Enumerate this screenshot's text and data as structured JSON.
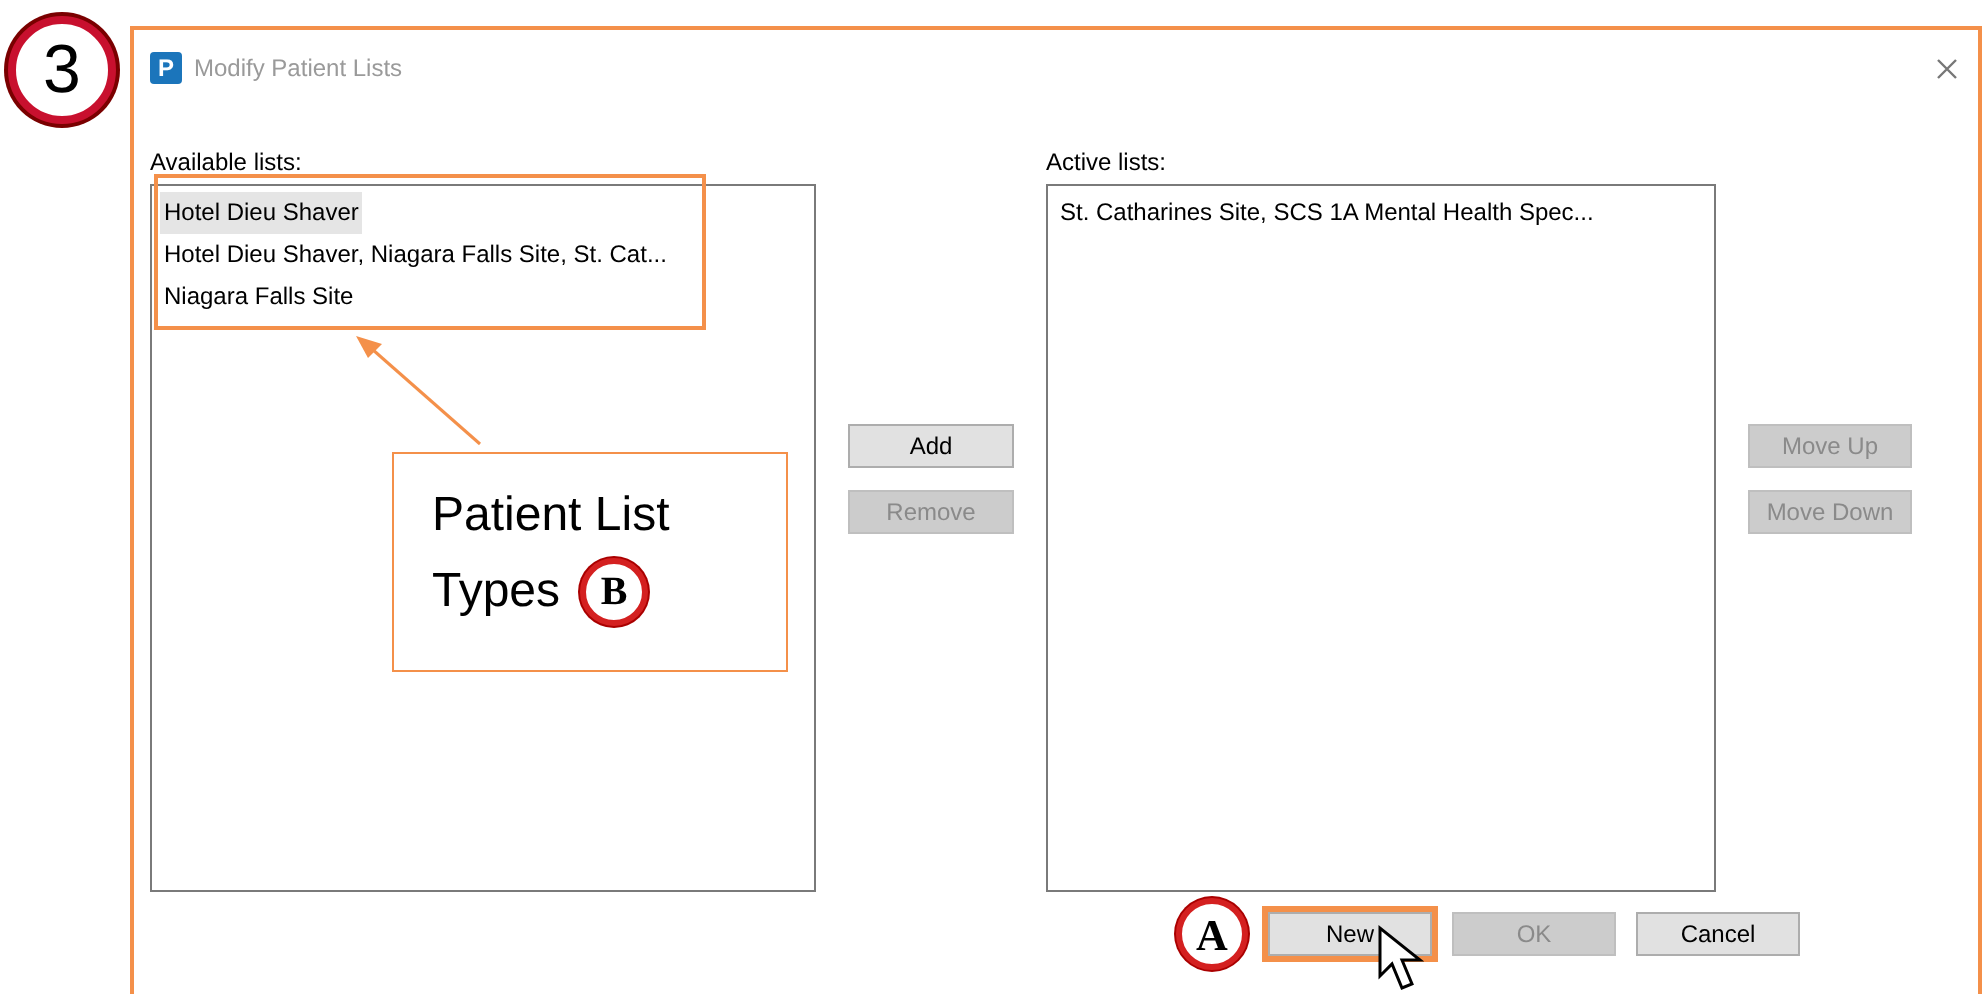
{
  "step_badge": "3",
  "window": {
    "title": "Modify Patient Lists",
    "app_icon_letter": "P"
  },
  "available": {
    "label": "Available lists:",
    "items": [
      {
        "text": "Hotel Dieu Shaver",
        "selected": true
      },
      {
        "text": "Hotel Dieu Shaver, Niagara Falls Site, St. Cat...",
        "selected": false
      },
      {
        "text": "Niagara Falls Site",
        "selected": false
      }
    ]
  },
  "transfer_buttons": [
    {
      "label": "Add",
      "disabled": false
    },
    {
      "label": "Remove",
      "disabled": true
    }
  ],
  "active": {
    "label": "Active lists:",
    "items": [
      {
        "text": "St. Catharines Site, SCS 1A Mental Health Spec...",
        "selected": false
      }
    ]
  },
  "order_buttons": [
    {
      "label": "Move Up",
      "disabled": true
    },
    {
      "label": "Move Down",
      "disabled": true
    }
  ],
  "bottom_buttons": [
    {
      "label": "New",
      "disabled": false,
      "highlighted": true
    },
    {
      "label": "OK",
      "disabled": true,
      "highlighted": false
    },
    {
      "label": "Cancel",
      "disabled": false,
      "highlighted": false
    }
  ],
  "callout": {
    "lines": [
      "Patient List",
      "Types"
    ],
    "marker": "B"
  },
  "button_marker": "A"
}
